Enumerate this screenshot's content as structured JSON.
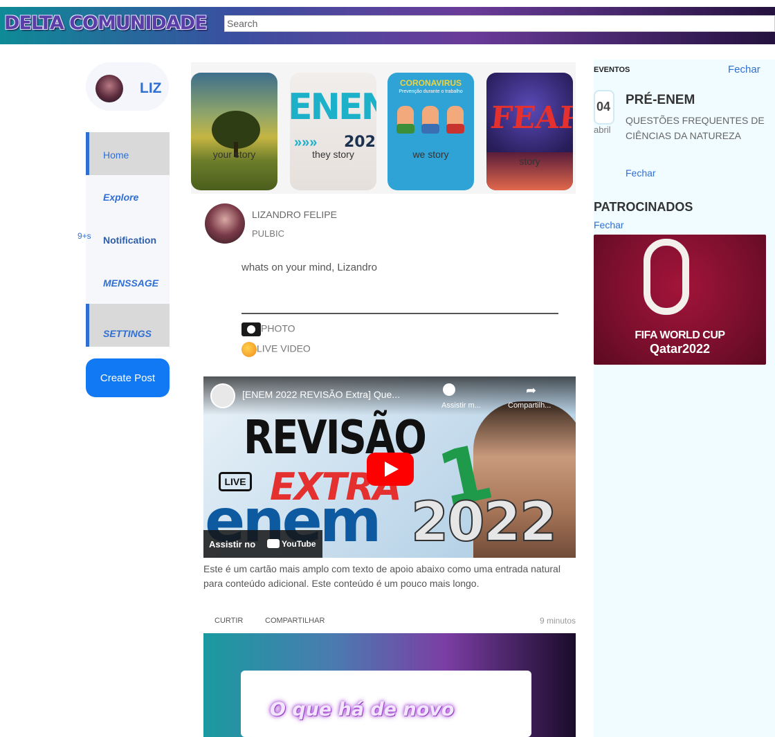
{
  "header": {
    "brand": "DELTA COMUNIDADE",
    "search_placeholder": "Search"
  },
  "profile": {
    "name": "LIZ"
  },
  "sidebar": {
    "items": [
      {
        "label": "Home"
      },
      {
        "label": "Explore"
      },
      {
        "label": "Notification",
        "badge": "9+s"
      },
      {
        "label": "MENSSAGE"
      },
      {
        "label": "SETTINGS"
      }
    ],
    "create_post": "Create Post"
  },
  "stories": [
    {
      "caption": "your story"
    },
    {
      "caption": "they story",
      "text": "ENEN",
      "year": "202",
      "arrows": "»»»"
    },
    {
      "caption": "we story",
      "heading": "CORONAVIRUS",
      "sub": "Prevenção durante o trabalho"
    },
    {
      "caption": "story",
      "heading": "FEAPI"
    }
  ],
  "composer": {
    "author": "LIZANDRO FELIPE",
    "visibility": "PULBIC",
    "prompt": "whats on your mind, Lizandro",
    "photo": "PHOTO",
    "live": "LIVE VIDEO"
  },
  "video_post": {
    "video_title": "[ENEM 2022 REVISÃO Extra] Que...",
    "watch_later": "Assistir m...",
    "share_label": "Compartilh...",
    "revisao": "REVISÃO",
    "live_tag": "LIVE",
    "extra": "EXTRA",
    "one": "1",
    "enem": "enem",
    "year": "2022",
    "watch_on": "Assistir no",
    "youtube": "YouTube",
    "text": "Este é um cartão mais amplo com texto de apoio abaixo como uma entrada natural para conteúdo adicional. Este conteúdo é um pouco mais longo.",
    "like": "CURTIR",
    "share": "COMPARTILHAR",
    "time": "9 minutos"
  },
  "post2": {
    "title": "O que há de novo"
  },
  "events": {
    "title": "EVENTOS",
    "close": "Fechar",
    "day": "04",
    "month": "abril",
    "name": "PRÉ-ENEM",
    "desc": "QUESTÕES FREQUENTES DE CIÊNCIAS DA NATUREZA",
    "close_item": "Fechar"
  },
  "sponsored": {
    "title": "PATROCINADOS",
    "close": "Fechar",
    "line1": "FIFA WORLD CUP",
    "line2": "Qatar2022"
  },
  "colors": {
    "accent": "#2f6fd4",
    "create_button": "#1279f5",
    "right_bg": "#f0fcff"
  }
}
